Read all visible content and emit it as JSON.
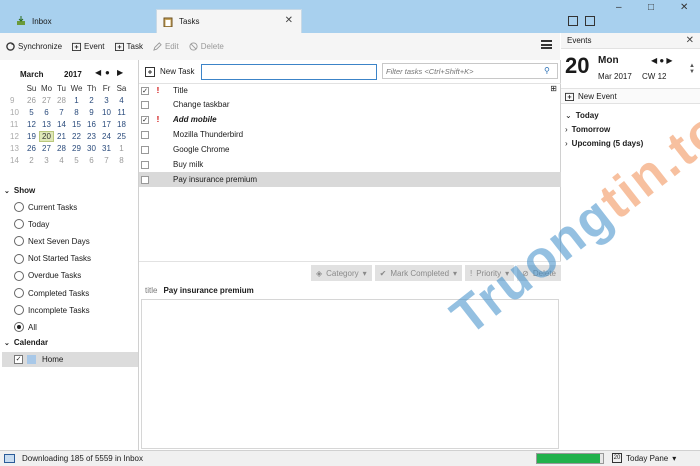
{
  "tabs": [
    {
      "label": "Inbox",
      "icon": "inbox-icon"
    },
    {
      "label": "Tasks",
      "icon": "tasks-icon"
    }
  ],
  "window": {
    "minimize": "–",
    "maximize": "□",
    "close": "✕"
  },
  "toolbar": {
    "synchronize": "Synchronize",
    "event": "Event",
    "task": "Task",
    "edit": "Edit",
    "delete": "Delete"
  },
  "minical": {
    "month": "March",
    "year": "2017",
    "weekdays": [
      "Su",
      "Mo",
      "Tu",
      "We",
      "Th",
      "Fr",
      "Sa"
    ],
    "weeks": [
      {
        "wk": "9",
        "days": [
          "26",
          "27",
          "28",
          "1",
          "2",
          "3",
          "4"
        ]
      },
      {
        "wk": "10",
        "days": [
          "5",
          "6",
          "7",
          "8",
          "9",
          "10",
          "11"
        ]
      },
      {
        "wk": "11",
        "days": [
          "12",
          "13",
          "14",
          "15",
          "16",
          "17",
          "18"
        ]
      },
      {
        "wk": "12",
        "days": [
          "19",
          "20",
          "21",
          "22",
          "23",
          "24",
          "25"
        ]
      },
      {
        "wk": "13",
        "days": [
          "26",
          "27",
          "28",
          "29",
          "30",
          "31",
          "1"
        ]
      },
      {
        "wk": "14",
        "days": [
          "2",
          "3",
          "4",
          "5",
          "6",
          "7",
          "8"
        ]
      }
    ]
  },
  "show": {
    "title": "Show",
    "filters": [
      "Current Tasks",
      "Today",
      "Next Seven Days",
      "Not Started Tasks",
      "Overdue Tasks",
      "Completed Tasks",
      "Incomplete Tasks",
      "All"
    ],
    "selected": "All"
  },
  "calendar": {
    "title": "Calendar",
    "item": "Home",
    "color": "#a8c8e8"
  },
  "newtask": {
    "label": "New Task",
    "value": ""
  },
  "filter_input": {
    "placeholder": "Filter tasks <Ctrl+Shift+K>"
  },
  "tasklist": {
    "header": "Title",
    "tasks": [
      {
        "title": "Change taskbar",
        "done": false,
        "priority": "",
        "emph": false,
        "selected": false
      },
      {
        "title": "Add mobile",
        "done": true,
        "priority": "!",
        "emph": true,
        "selected": false
      },
      {
        "title": "Mozilla Thunderbird",
        "done": false,
        "priority": "",
        "emph": false,
        "selected": false
      },
      {
        "title": "Google Chrome",
        "done": false,
        "priority": "",
        "emph": false,
        "selected": false
      },
      {
        "title": "Buy milk",
        "done": false,
        "priority": "",
        "emph": false,
        "selected": false
      },
      {
        "title": "Pay insurance premium",
        "done": false,
        "priority": "",
        "emph": false,
        "selected": true
      }
    ]
  },
  "details": {
    "buttons": {
      "category": "Category",
      "mark_completed": "Mark Completed",
      "priority": "Priority",
      "delete": "Delete"
    },
    "title_label": "title",
    "title_value": "Pay insurance premium"
  },
  "today_pane": {
    "header": "Events",
    "day_number": "20",
    "day_name": "Mon",
    "month_year": "Mar 2017",
    "calendar_week": "CW 12",
    "new_event": "New Event",
    "agenda": [
      "Today",
      "Tomorrow",
      "Upcoming (5 days)"
    ]
  },
  "status": {
    "text": "Downloading 185 of 5559 in Inbox",
    "progress": 0.95,
    "today_pane_label": "Today Pane"
  },
  "watermark": {
    "part1": "Truong",
    "part2": "tin.top"
  }
}
